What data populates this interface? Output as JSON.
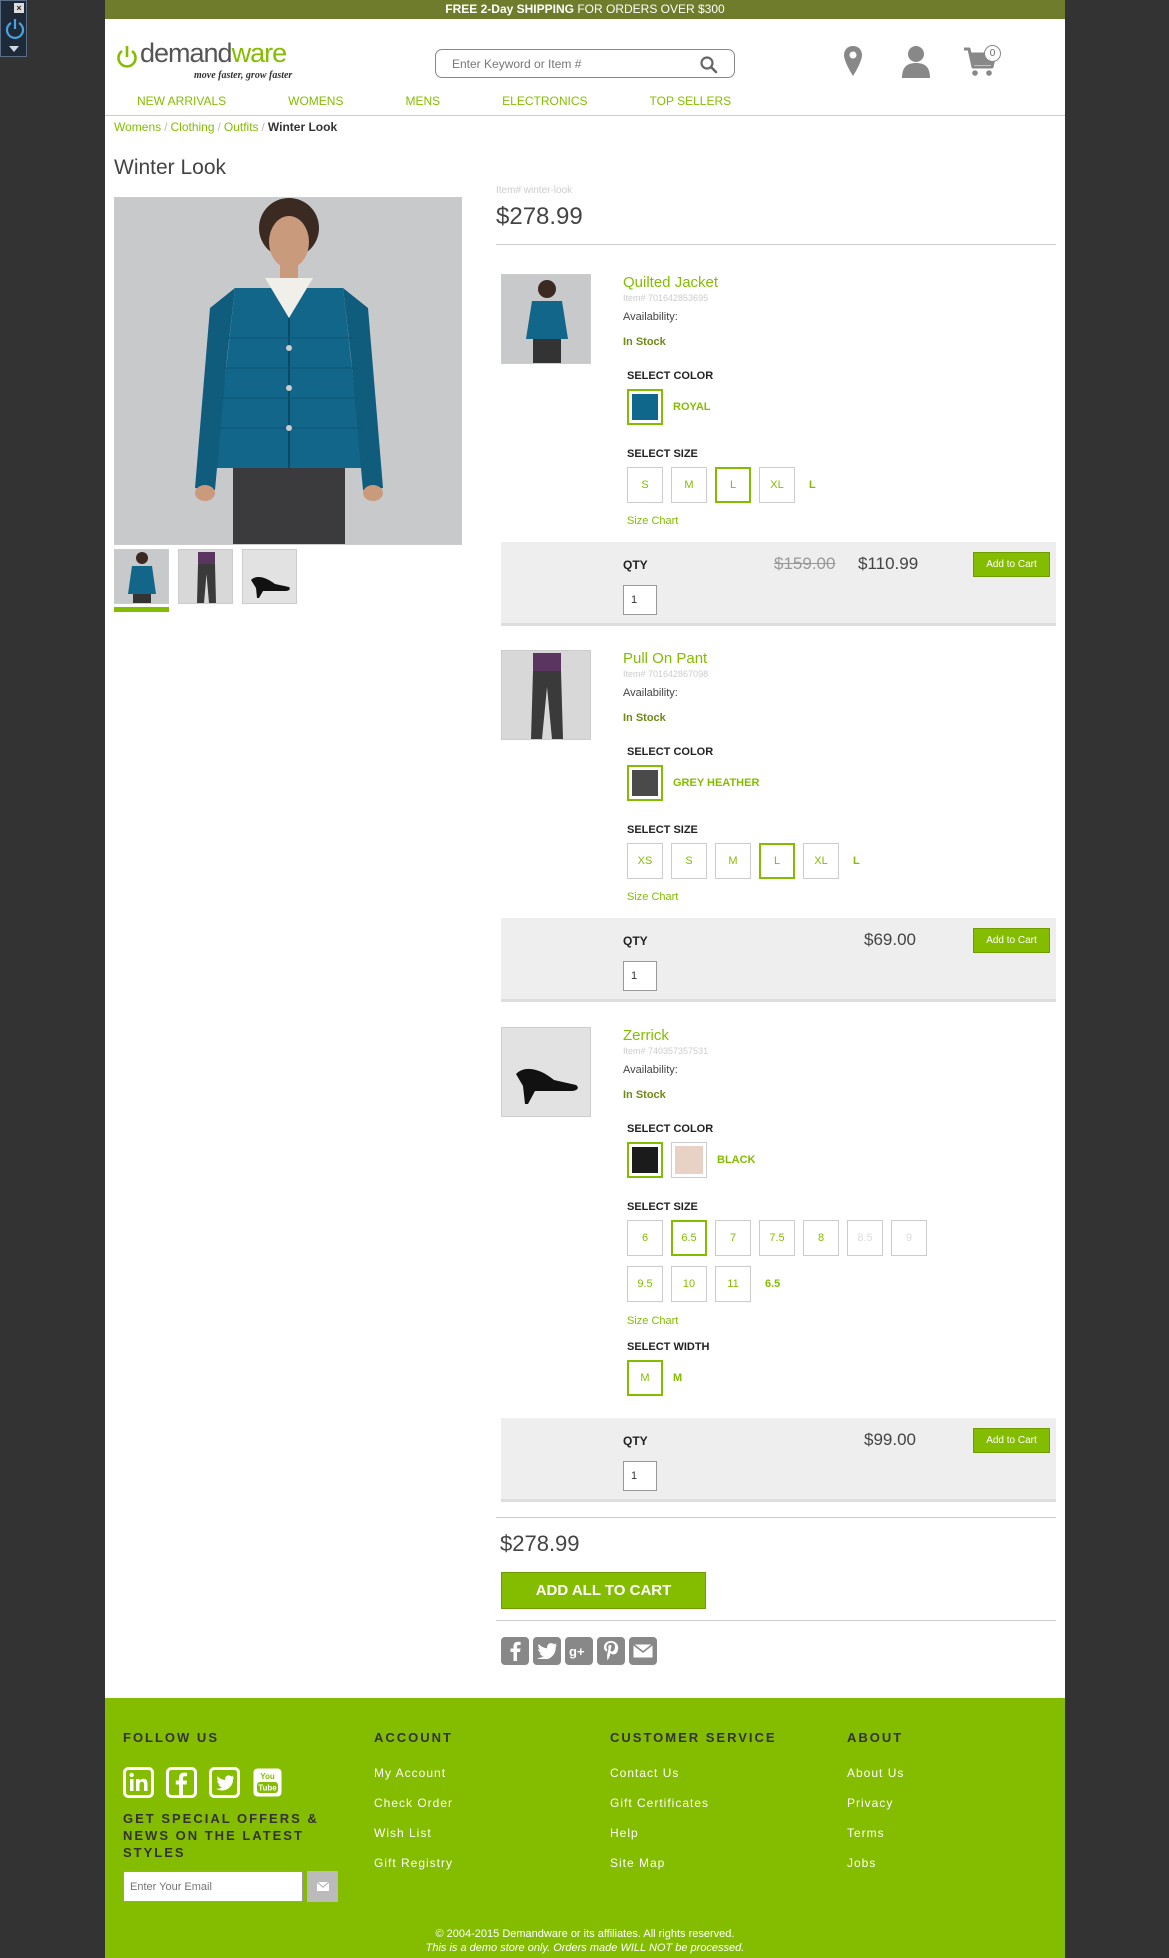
{
  "promo": {
    "bold": "FREE 2-Day SHIPPING",
    "rest": " FOR ORDERS OVER $300"
  },
  "logo": {
    "word_a": "demand",
    "word_b": "ware",
    "tagline": "move faster, grow faster"
  },
  "search": {
    "placeholder": "Enter Keyword or Item #"
  },
  "cart": {
    "count": "0"
  },
  "nav": [
    "NEW ARRIVALS",
    "WOMENS",
    "MENS",
    "ELECTRONICS",
    "TOP SELLERS"
  ],
  "breadcrumb": [
    "Womens",
    "Clothing",
    "Outfits",
    "Winter Look"
  ],
  "page_title": "Winter Look",
  "set": {
    "item_no": "Item# winter-look",
    "price": "$278.99"
  },
  "labels": {
    "availability": "Availability:",
    "in_stock": "In Stock",
    "select_color": "SELECT COLOR",
    "select_size": "SELECT SIZE",
    "select_width": "SELECT WIDTH",
    "size_chart": "Size Chart",
    "qty": "QTY",
    "add_to_cart": "Add to Cart"
  },
  "products": [
    {
      "name": "Quilted Jacket",
      "item": "Item# 701642853695",
      "color_selected": "ROYAL",
      "colors": [
        "#10678c"
      ],
      "sizes": [
        "S",
        "M",
        "L",
        "XL"
      ],
      "size_selected": "L",
      "qty": "1",
      "old_price": "$159.00",
      "price": "$110.99"
    },
    {
      "name": "Pull On Pant",
      "item": "Item# 701642867098",
      "color_selected": "GREY HEATHER",
      "colors": [
        "#4a4a4a"
      ],
      "sizes": [
        "XS",
        "S",
        "M",
        "L",
        "XL"
      ],
      "size_selected": "L",
      "qty": "1",
      "price": "$69.00"
    },
    {
      "name": "Zerrick",
      "item": "Item# 740357357531",
      "color_selected": "BLACK",
      "colors": [
        "#1b1b1b",
        "#e8d2c6"
      ],
      "sizes": [
        "6",
        "6.5",
        "7",
        "7.5",
        "8",
        "8.5",
        "9",
        "9.5",
        "10",
        "11"
      ],
      "size_selected": "6.5",
      "width": "M",
      "qty": "1",
      "price": "$99.00"
    }
  ],
  "bottom": {
    "total": "$278.99",
    "add_all": "ADD ALL TO CART"
  },
  "share_icons": [
    "facebook-icon",
    "twitter-icon",
    "googleplus-icon",
    "pinterest-icon",
    "email-icon"
  ],
  "footer": {
    "follow_us": "FOLLOW US",
    "offers": "GET SPECIAL OFFERS & NEWS ON THE LATEST STYLES",
    "email_placeholder": "Enter Your Email",
    "account": {
      "title": "ACCOUNT",
      "links": [
        "My Account",
        "Check Order",
        "Wish List",
        "Gift Registry"
      ]
    },
    "service": {
      "title": "CUSTOMER SERVICE",
      "links": [
        "Contact Us",
        "Gift Certificates",
        "Help",
        "Site Map"
      ]
    },
    "about": {
      "title": "ABOUT",
      "links": [
        "About Us",
        "Privacy",
        "Terms",
        "Jobs"
      ]
    },
    "copyright": "© 2004-2015 Demandware or its affiliates. All rights reserved.",
    "demo_note": "This is a demo store only. Orders made WILL NOT be processed."
  },
  "colors": {
    "brand_green": "#84bd00",
    "promo_bar": "#6f7c2c",
    "page_bg": "#333333"
  }
}
